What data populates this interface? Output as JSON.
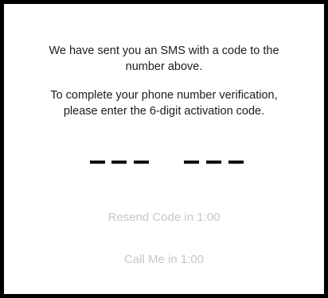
{
  "verification": {
    "sent_message": {
      "line1": "We have sent you an SMS with a code to the",
      "line2": "number above."
    },
    "instruction": {
      "line1": "To complete your phone number verification,",
      "line2": "please enter the 6-digit activation code."
    },
    "code_length": 6,
    "code_value": "",
    "resend_label": "Resend Code in 1:00",
    "call_label": "Call Me in 1:00"
  },
  "colors": {
    "text": "#1c1c1e",
    "disabled_text": "#c7c7cc",
    "slot": "#111111",
    "background": "#ffffff",
    "frame": "#000000"
  }
}
